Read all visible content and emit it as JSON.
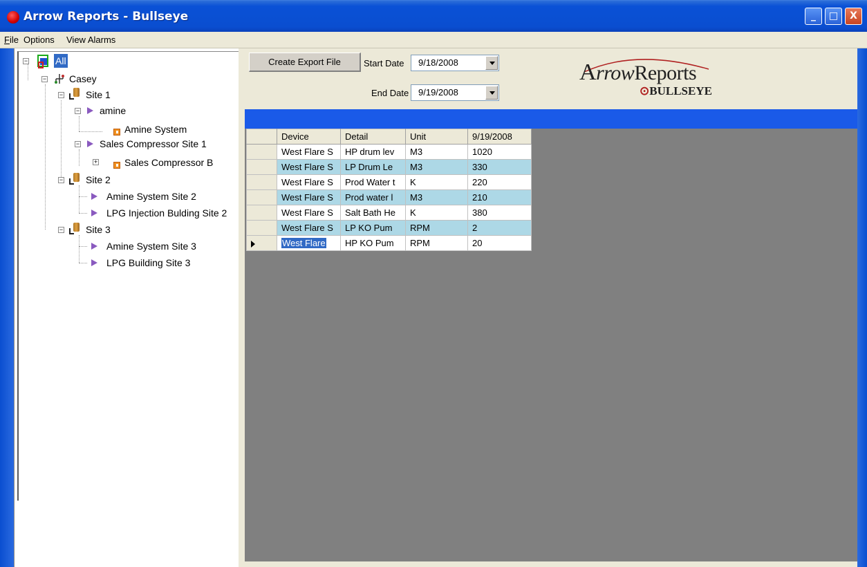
{
  "window": {
    "title": "Arrow Reports - Bullseye",
    "controls": {
      "minimize": "_",
      "maximize": "□",
      "close": "X"
    }
  },
  "menu": {
    "file": {
      "mnemonic": "F",
      "rest": "ile"
    },
    "options": "Options",
    "view_alarms": "View Alarms"
  },
  "tree": {
    "root": "All",
    "casey": "Casey",
    "site1": "Site 1",
    "amine": "amine",
    "amine_system": "Amine System",
    "sales_comp_site1": "Sales Compressor Site 1",
    "sales_comp_b": "Sales Compressor B",
    "site2": "Site 2",
    "amine_site2": "Amine System Site 2",
    "lpg_inj_site2": "LPG Injection Bulding Site 2",
    "site3": "Site 3",
    "amine_site3": "Amine System Site 3",
    "lpg_building_site3": "LPG Building Site 3",
    "expander_open": "−",
    "expander_closed": "+"
  },
  "toolbar": {
    "export_label": "Create Export File",
    "start_label": "Start Date",
    "start_value": "9/18/2008",
    "end_label": "End Date",
    "end_value": "9/19/2008"
  },
  "logo": {
    "arrow_initial": "A",
    "arrow_rest": "rrow",
    "reports": "Reports",
    "bullseye_mark": "⊙",
    "bullseye": "BULLSEYE"
  },
  "grid": {
    "columns": [
      "Device",
      "Detail",
      "Unit",
      "9/19/2008"
    ],
    "rows": [
      {
        "device": "West Flare S",
        "detail": "HP drum lev",
        "unit": "M3",
        "value": "1020"
      },
      {
        "device": "West Flare S",
        "detail": "LP Drum Le",
        "unit": "M3",
        "value": "330"
      },
      {
        "device": "West Flare S",
        "detail": "Prod Water t",
        "unit": "K",
        "value": "220"
      },
      {
        "device": "West Flare S",
        "detail": "Prod water l",
        "unit": "M3",
        "value": "210"
      },
      {
        "device": "West Flare S",
        "detail": "Salt Bath He",
        "unit": "K",
        "value": "380"
      },
      {
        "device": "West Flare S",
        "detail": "LP KO Pum",
        "unit": "RPM",
        "value": "2"
      },
      {
        "device": "West Flare",
        "detail": "HP KO Pum",
        "unit": "RPM",
        "value": "20"
      }
    ],
    "current_row": 6
  }
}
